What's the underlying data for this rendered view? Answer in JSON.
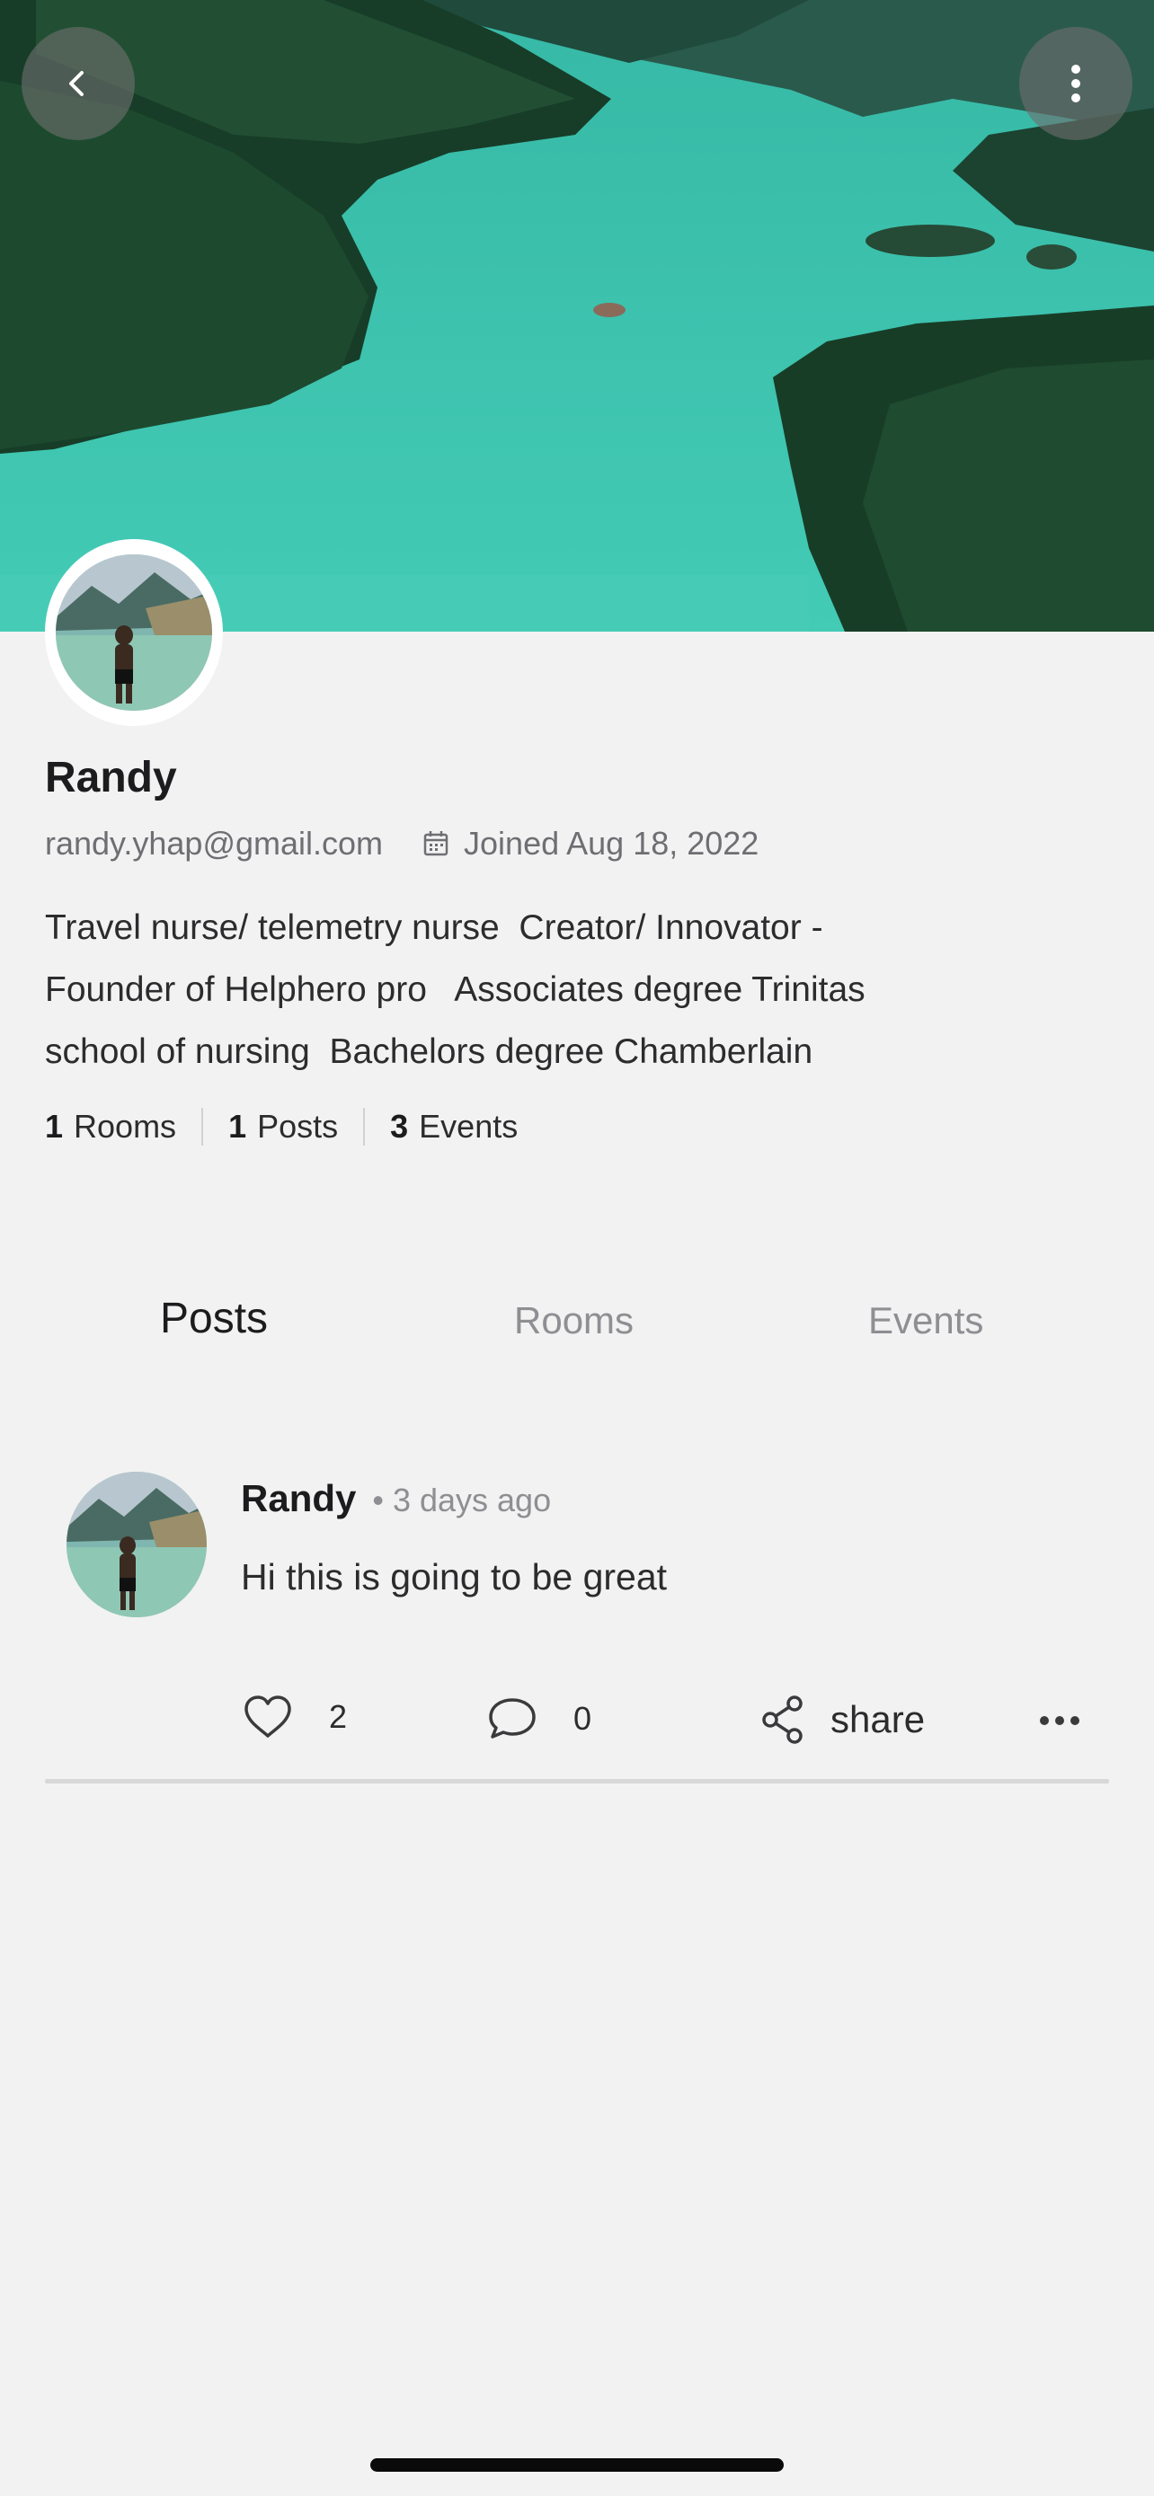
{
  "profile": {
    "name": "Randy",
    "email": "randy.yhap@gmail.com",
    "joined": "Joined Aug 18, 2022",
    "bio": "Travel nurse/ telemetry nurse  Creator/ Innovator -\nFounder of Helphero pro   Associates degree Trinitas\nschool of nursing  Bachelors degree Chamberlain"
  },
  "stats": [
    {
      "count": "1",
      "label": "Rooms"
    },
    {
      "count": "1",
      "label": "Posts"
    },
    {
      "count": "3",
      "label": "Events"
    }
  ],
  "tabs": [
    {
      "label": "Posts",
      "active": true
    },
    {
      "label": "Rooms",
      "active": false
    },
    {
      "label": "Events",
      "active": false
    }
  ],
  "post": {
    "author": "Randy",
    "time": "• 3 days ago",
    "text": "Hi this is going to be great",
    "likes": "2",
    "comments": "0",
    "share_label": "share"
  },
  "icons": {
    "back": "chevron-left-icon",
    "more": "vertical-ellipsis-icon",
    "calendar": "calendar-icon",
    "like": "heart-icon",
    "comment": "comment-bubble-icon",
    "share": "share-icon",
    "post_more": "horizontal-ellipsis-icon"
  },
  "colors": {
    "background": "#f2f2f2",
    "primary_text": "#1c1c1e",
    "secondary_text": "#8e8e93",
    "water": "#3ec4b0"
  }
}
